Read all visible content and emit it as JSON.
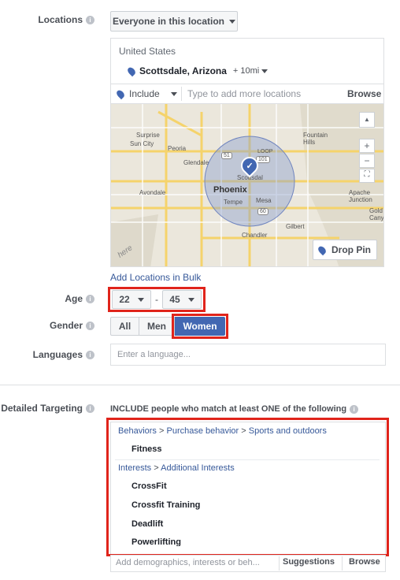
{
  "locations": {
    "label": "Locations",
    "dropdown": "Everyone in this location",
    "country": "United States",
    "city": "Scottsdale, Arizona",
    "radius": "+ 10mi",
    "include": "Include",
    "placeholder": "Type to add more locations",
    "browse": "Browse",
    "drop_pin": "Drop Pin",
    "bulk_link": "Add Locations in Bulk",
    "map_labels": {
      "surprise": "Surprise",
      "sun_city": "Sun City",
      "peoria": "Peoria",
      "glendale": "Glendale",
      "scottsdale": "Scottsdal",
      "phoenix": "Phoenix",
      "tempe": "Tempe",
      "mesa": "Mesa",
      "avondale": "Avondale",
      "gilbert": "Gilbert",
      "chandler": "Chandler",
      "fountain_hills": "Fountain Hills",
      "apache_junction": "Apache Junction",
      "gold_canyon": "Gold Canyo",
      "loop": "LOOP",
      "r51": "51",
      "r101": "101",
      "r60": "60",
      "here": "here"
    },
    "zoom_in": "+",
    "zoom_out": "−",
    "up_icon": "▲"
  },
  "age": {
    "label": "Age",
    "min": "22",
    "max": "45",
    "sep": "-"
  },
  "gender": {
    "label": "Gender",
    "all": "All",
    "men": "Men",
    "women": "Women"
  },
  "languages": {
    "label": "Languages",
    "placeholder": "Enter a language..."
  },
  "detailed": {
    "label": "Detailed Targeting",
    "header": "INCLUDE people who match at least ONE of the following",
    "groups": [
      {
        "path": [
          "Behaviors",
          "Purchase behavior",
          "Sports and outdoors"
        ],
        "items": [
          "Fitness"
        ]
      },
      {
        "path": [
          "Interests",
          "Additional Interests"
        ],
        "items": [
          "CrossFit",
          "Crossfit Training",
          "Deadlift",
          "Powerlifting"
        ]
      }
    ],
    "sep": ">",
    "placeholder": "Add demographics, interests or beh...",
    "suggestions": "Suggestions",
    "browse": "Browse"
  },
  "colors": {
    "accent": "#4267b2",
    "highlight": "#e0241b",
    "link": "#365899"
  }
}
